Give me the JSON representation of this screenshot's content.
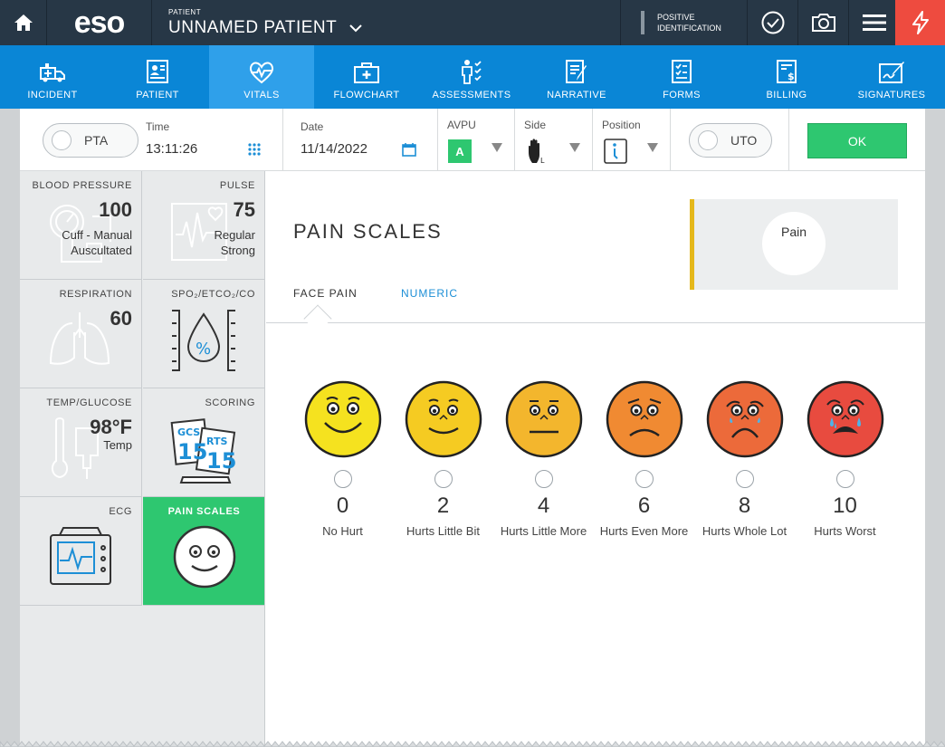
{
  "topbar": {
    "logo": "eso",
    "patient_caption": "PATIENT",
    "patient_name": "UNNAMED PATIENT",
    "positive_id_line1": "POSITIVE",
    "positive_id_line2": "IDENTIFICATION"
  },
  "nav": {
    "items": [
      {
        "label": "INCIDENT"
      },
      {
        "label": "PATIENT"
      },
      {
        "label": "VITALS"
      },
      {
        "label": "FLOWCHART"
      },
      {
        "label": "ASSESSMENTS"
      },
      {
        "label": "NARRATIVE"
      },
      {
        "label": "FORMS"
      },
      {
        "label": "BILLING"
      },
      {
        "label": "SIGNATURES"
      }
    ],
    "active": "VITALS"
  },
  "toolbar": {
    "pta": "PTA",
    "time_label": "Time",
    "time_value": "13:11:26",
    "date_label": "Date",
    "date_value": "11/14/2022",
    "avpu_label": "AVPU",
    "avpu_value": "A",
    "side_label": "Side",
    "position_label": "Position",
    "uto": "UTO",
    "ok": "OK"
  },
  "tiles": {
    "bp": {
      "title": "BLOOD PRESSURE",
      "value": "100",
      "sub1": "Cuff - Manual",
      "sub2": "Auscultated"
    },
    "pulse": {
      "title": "PULSE",
      "value": "75",
      "sub1": "Regular",
      "sub2": "Strong"
    },
    "resp": {
      "title": "RESPIRATION",
      "value": "60"
    },
    "spo2": {
      "title": "SPO₂/ETCO₂/CO"
    },
    "temp": {
      "title": "TEMP/GLUCOSE",
      "value": "98°F",
      "sub1": "Temp"
    },
    "scoring": {
      "title": "SCORING",
      "gcs": "GCS",
      "gcs_val": "15",
      "rts": "RTS",
      "rts_val": "15"
    },
    "ecg": {
      "title": "ECG"
    },
    "pain": {
      "title": "PAIN SCALES"
    }
  },
  "content": {
    "title": "PAIN SCALES",
    "tab_face": "FACE PAIN",
    "tab_numeric": "NUMERIC",
    "pain_box_label": "Pain",
    "faces": [
      {
        "score": "0",
        "label": "No Hurt",
        "color": "#f5e21f"
      },
      {
        "score": "2",
        "label": "Hurts Little Bit",
        "color": "#f5cb22"
      },
      {
        "score": "4",
        "label": "Hurts Little More",
        "color": "#f3b62d"
      },
      {
        "score": "6",
        "label": "Hurts Even More",
        "color": "#f08a32"
      },
      {
        "score": "8",
        "label": "Hurts Whole Lot",
        "color": "#ec6a3a"
      },
      {
        "score": "10",
        "label": "Hurts Worst",
        "color": "#e84b3f"
      }
    ]
  },
  "colors": {
    "topbar": "#273746",
    "nav": "#0a86d6",
    "nav_active": "#2fa0ea",
    "accent_green": "#2ec770",
    "flash_red": "#ee4b3f"
  }
}
